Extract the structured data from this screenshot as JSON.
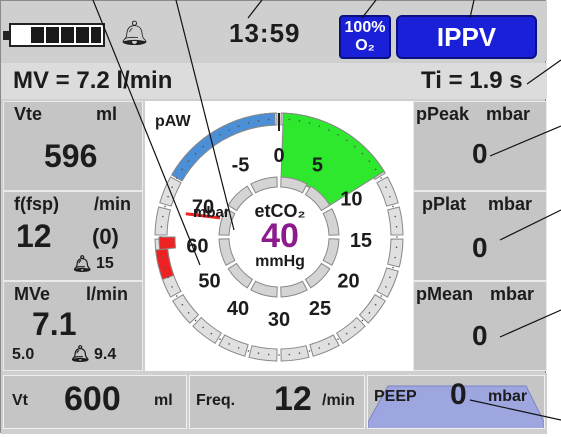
{
  "header": {
    "clock": "13:59",
    "o2": {
      "percent": "100%",
      "label": "O₂"
    },
    "mode": "IPPV"
  },
  "status": {
    "mv": "MV = 7.2 l/min",
    "ti": "Ti = 1.9 s"
  },
  "left_panels": [
    {
      "name": "Vte",
      "unit": "ml",
      "value": "596"
    },
    {
      "name": "f(fsp)",
      "unit": "/min",
      "value": "12",
      "secondary": "(0)",
      "alarm": "15"
    },
    {
      "name": "MVe",
      "unit": "l/min",
      "value": "7.1",
      "low": "5.0",
      "high": "9.4"
    }
  ],
  "right_panels": [
    {
      "name": "pPeak",
      "unit": "mbar",
      "value": "0"
    },
    {
      "name": "pPlat",
      "unit": "mbar",
      "value": "0"
    },
    {
      "name": "pMean",
      "unit": "mbar",
      "value": "0"
    }
  ],
  "gauge": {
    "title": "pAW",
    "unit_label": "mbar",
    "scale_labels": [
      "-5",
      "0",
      "5",
      "10",
      "15",
      "20",
      "25",
      "30",
      "40",
      "50",
      "60",
      "70"
    ],
    "center_label": "etCO₂",
    "center_value": "40",
    "center_unit": "mmHg",
    "colors": {
      "blue_zone": "#4b8fd6",
      "green_zone": "#2ee82e",
      "red_zone": "#ee2222",
      "value": "#8c1a8c"
    }
  },
  "bottom": {
    "vt": {
      "name": "Vt",
      "value": "600",
      "unit": "ml"
    },
    "freq": {
      "name": "Freq.",
      "value": "12",
      "unit": "/min"
    },
    "peep": {
      "name": "PEEP",
      "value": "0",
      "unit": "mbar"
    }
  },
  "icons": [
    "battery-icon",
    "bell-icon",
    "alarm-bell-icon"
  ]
}
